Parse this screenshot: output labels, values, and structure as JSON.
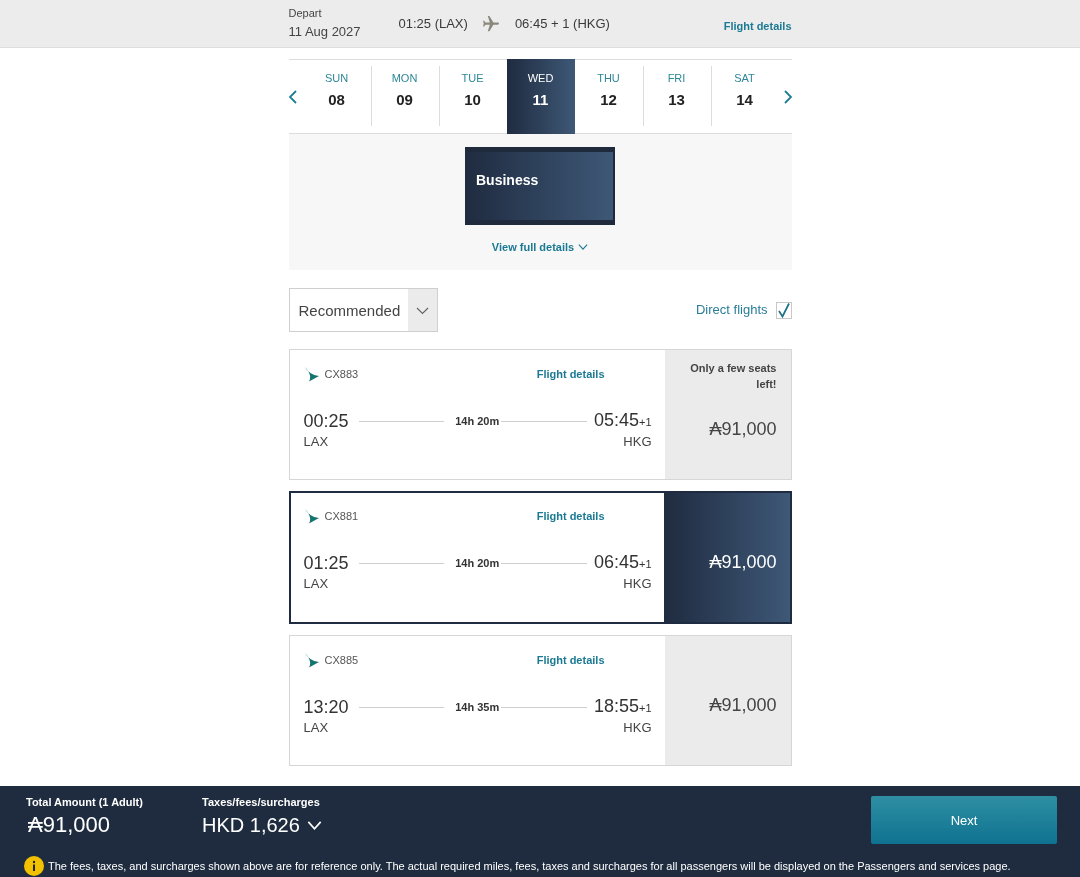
{
  "header": {
    "label": "Depart",
    "date": "11 Aug 2027",
    "departure": "01:25 (LAX)",
    "arrival": "06:45 + 1 (HKG)",
    "link": "Flight details"
  },
  "date_strip": {
    "days": [
      {
        "weekday": "SUN",
        "day": "08",
        "selected": false
      },
      {
        "weekday": "MON",
        "day": "09",
        "selected": false
      },
      {
        "weekday": "TUE",
        "day": "10",
        "selected": false
      },
      {
        "weekday": "WED",
        "day": "11",
        "selected": true
      },
      {
        "weekday": "THU",
        "day": "12",
        "selected": false
      },
      {
        "weekday": "FRI",
        "day": "13",
        "selected": false
      },
      {
        "weekday": "SAT",
        "day": "14",
        "selected": false
      }
    ]
  },
  "cabin_panel": {
    "cabins": [
      {
        "label": "Business",
        "selected": true
      }
    ],
    "details_link": "View full details"
  },
  "sort": {
    "value": "Recommended"
  },
  "direct_flights": {
    "label": "Direct flights",
    "checked": true
  },
  "flights": [
    {
      "number": "CX883",
      "details_link": "Flight details",
      "departure_time": "00:25",
      "origin": "LAX",
      "duration": "14h 20m",
      "arrival_time": "05:45",
      "day_offset": "+1",
      "destination": "HKG",
      "seats_notice": "Only a few seats left!",
      "price": "₳91,000",
      "selected": false
    },
    {
      "number": "CX881",
      "details_link": "Flight details",
      "departure_time": "01:25",
      "origin": "LAX",
      "duration": "14h 20m",
      "arrival_time": "06:45",
      "day_offset": "+1",
      "destination": "HKG",
      "price": "₳91,000",
      "selected": true
    },
    {
      "number": "CX885",
      "details_link": "Flight details",
      "departure_time": "13:20",
      "origin": "LAX",
      "duration": "14h 35m",
      "arrival_time": "18:55",
      "day_offset": "+1",
      "destination": "HKG",
      "price": "₳91,000",
      "selected": false
    }
  ],
  "footer": {
    "total_label": "Total Amount (1 Adult)",
    "total": "₳91,000",
    "taxes_label": "Taxes/fees/surcharges",
    "taxes": "HKD 1,626",
    "next_button": "Next",
    "notice": "The fees, taxes, and surcharges shown above are for reference only. The actual required miles, fees, taxes and surcharges for all passengers will be displayed on the Passengers and services page."
  }
}
